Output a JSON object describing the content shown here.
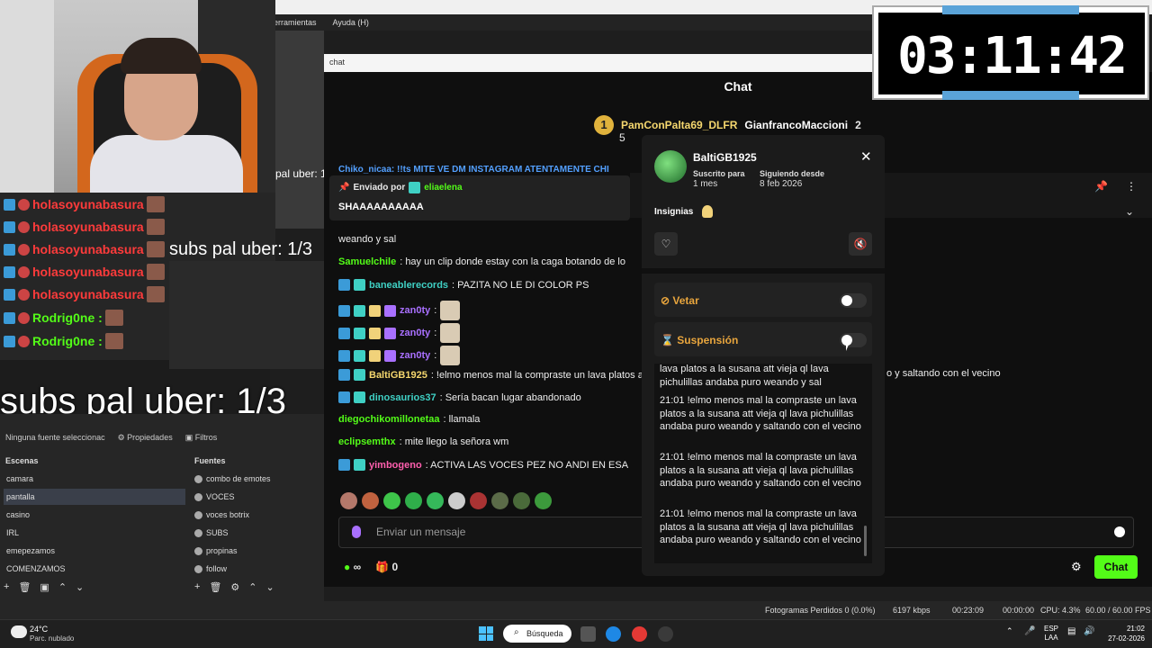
{
  "obs": {
    "menu": [
      "erramientas",
      "Ayuda (H)"
    ],
    "preview_label": "pal uber: 1",
    "source_bar": {
      "none": "Ninguna fuente seleccionac",
      "props": "Propiedades",
      "filters": "Filtros"
    },
    "scenes_title": "Escenas",
    "sources_title": "Fuentes",
    "scenes": [
      "camara",
      "pantalla",
      "casino",
      "IRL",
      "emepezamos",
      "COMENZAMOS"
    ],
    "active_scene": "pantalla",
    "sources": [
      "combo de emotes",
      "VOCES",
      "voces botrix",
      "SUBS",
      "propinas",
      "follow"
    ],
    "status": {
      "dropped": "Fotogramas Perdidos 0 (0.0%)",
      "kbps": "6197 kbps",
      "live": "00:23:09",
      "rec": "00:00:00",
      "cpu": "CPU: 4.3%",
      "fps": "60.00 / 60.00 FPS"
    }
  },
  "overlay": {
    "left_chat": [
      {
        "user": "holasoyunabasura",
        "color": "#ff3b3b"
      },
      {
        "user": "holasoyunabasura",
        "color": "#ff3b3b"
      },
      {
        "user": "holasoyunabasura",
        "color": "#ff3b3b"
      },
      {
        "user": "holasoyunabasura",
        "color": "#ff3b3b"
      },
      {
        "user": "holasoyunabasura",
        "color": "#ff3b3b"
      },
      {
        "user": "Rodrig0ne :",
        "color": "#53fc18"
      },
      {
        "user": "Rodrig0ne :",
        "color": "#53fc18"
      }
    ],
    "subs_small": "subs pal uber: 1/3",
    "subs_big": "subs pal uber: 1/3"
  },
  "timer": {
    "value": "03:11:42"
  },
  "chat_window": {
    "titlebar": "chat",
    "header": "Chat",
    "gifter": {
      "rank": "1",
      "name": "PamConPalta69_DLFR",
      "count": "5",
      "second": "GianfrancoMaccioni",
      "second_count": "2"
    },
    "cut_line": "Chiko_nicaa: !!ts MITE VE DM INSTAGRAM ATENTAMENTE CHI",
    "pinned": {
      "prefix": "Enviado por",
      "user": "eliaelena",
      "message": "SHAAAAAAAAAA"
    },
    "messages": [
      {
        "user": "",
        "text": "weando y sal",
        "cls": ""
      },
      {
        "user": "Samuelchile",
        "text": ": hay un clip donde estay con la caga botando de lo",
        "cls": "u-green"
      },
      {
        "user": "baneablerecords",
        "text": ": PAZITA NO LE DI COLOR PS",
        "cls": "u-teal"
      },
      {
        "user": "zan0ty",
        "text": ":",
        "cls": "u-purple"
      },
      {
        "user": "zan0ty",
        "text": ":",
        "cls": "u-purple"
      },
      {
        "user": "zan0ty",
        "text": ":",
        "cls": "u-purple"
      },
      {
        "user": "BaltiGB1925",
        "text": ": !elmo menos mal la compraste un lava platos a",
        "cls": "u-yellow"
      },
      {
        "user": "dinosaurios37",
        "text": ": Sería bacan lugar abandonado",
        "cls": "u-teal"
      },
      {
        "user": "diegochikomillonetaa",
        "text": ": llamala",
        "cls": "u-green"
      },
      {
        "user": "eclipsemthx",
        "text": ": mite llego la señora wm",
        "cls": "u-green"
      },
      {
        "user": "yimbogeno",
        "text": ": ACTIVA LAS VOCES PEZ NO ANDI EN ESA",
        "cls": "u-pink"
      }
    ],
    "right_cut": "o y saltando con el vecino",
    "input_placeholder": "Enviar un mensaje",
    "infinity": "∞",
    "gift_count": "0",
    "send_label": "Chat"
  },
  "user_card": {
    "name": "BaltiGB1925",
    "sub_label": "Suscrito para",
    "sub_value": "1 mes",
    "follow_label": "Siguiendo desde",
    "follow_value": "8 feb 2026",
    "badges_label": "Insignias",
    "ban_label": "Vetar",
    "timeout_label": "Suspensión",
    "history": [
      "lava platos a la susana att vieja ql lava pichulillas andaba puro weando y sal",
      "21:01 !elmo menos mal la compraste un lava platos a la susana att vieja ql lava pichulillas andaba puro weando y saltando con el vecino",
      "21:01 !elmo menos mal la compraste un lava platos a la susana att vieja ql lava pichulillas andaba puro weando y saltando con el vecino",
      "21:01 !elmo menos mal la compraste un lava platos a la susana att vieja ql lava pichulillas andaba puro weando y saltando con el vecino"
    ]
  },
  "taskbar": {
    "temp": "24°C",
    "weather": "Parc. nublado",
    "search": "Búsqueda",
    "lang_top": "ESP",
    "lang_bot": "LAA",
    "time": "21:02",
    "date": "27-02-2026"
  },
  "colors": {
    "kick_green": "#53fc18",
    "timer_blue": "#5aa3d8"
  }
}
